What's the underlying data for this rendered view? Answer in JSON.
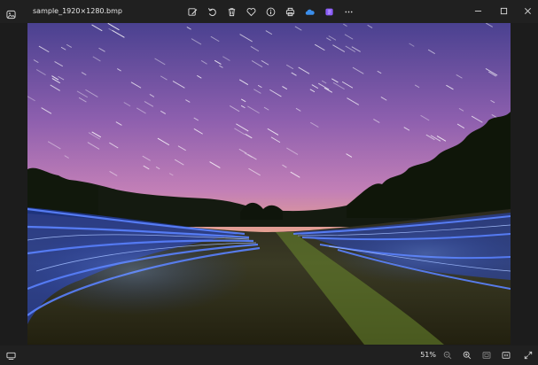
{
  "window": {
    "file_name": "sample_1920×1280.bmp",
    "app_icon": "photos-app-icon",
    "controls": [
      "minimize-icon",
      "maximize-icon",
      "close-icon"
    ]
  },
  "toolbar": {
    "buttons": [
      "edit-image-icon",
      "rotate-icon",
      "delete-icon",
      "favorite-heart-icon",
      "info-icon",
      "print-icon",
      "onedrive-cloud-icon",
      "clipchamp-icon",
      "more-options-icon"
    ],
    "accent_colors": {
      "onedrive": "#3b8eea",
      "clipchamp": "#8a5cf6"
    }
  },
  "status_bar": {
    "zoom_label": "51%",
    "buttons": [
      "filmstrip-icon",
      "zoom-out-icon",
      "zoom-in-icon",
      "fit-to-window-icon",
      "actual-size-icon",
      "fullscreen-icon"
    ]
  },
  "photo": {
    "subject": "long-exposure night photo: star trails in a purple sky over a sunset horizon with trees and blue light painting across a grassy field",
    "colors": {
      "sky_top": "#5a4a8f",
      "sky_mid": "#b56fb5",
      "horizon": "#f2b96a",
      "light_trail": "#2f5dff",
      "grass": "#4a6b2a"
    }
  }
}
